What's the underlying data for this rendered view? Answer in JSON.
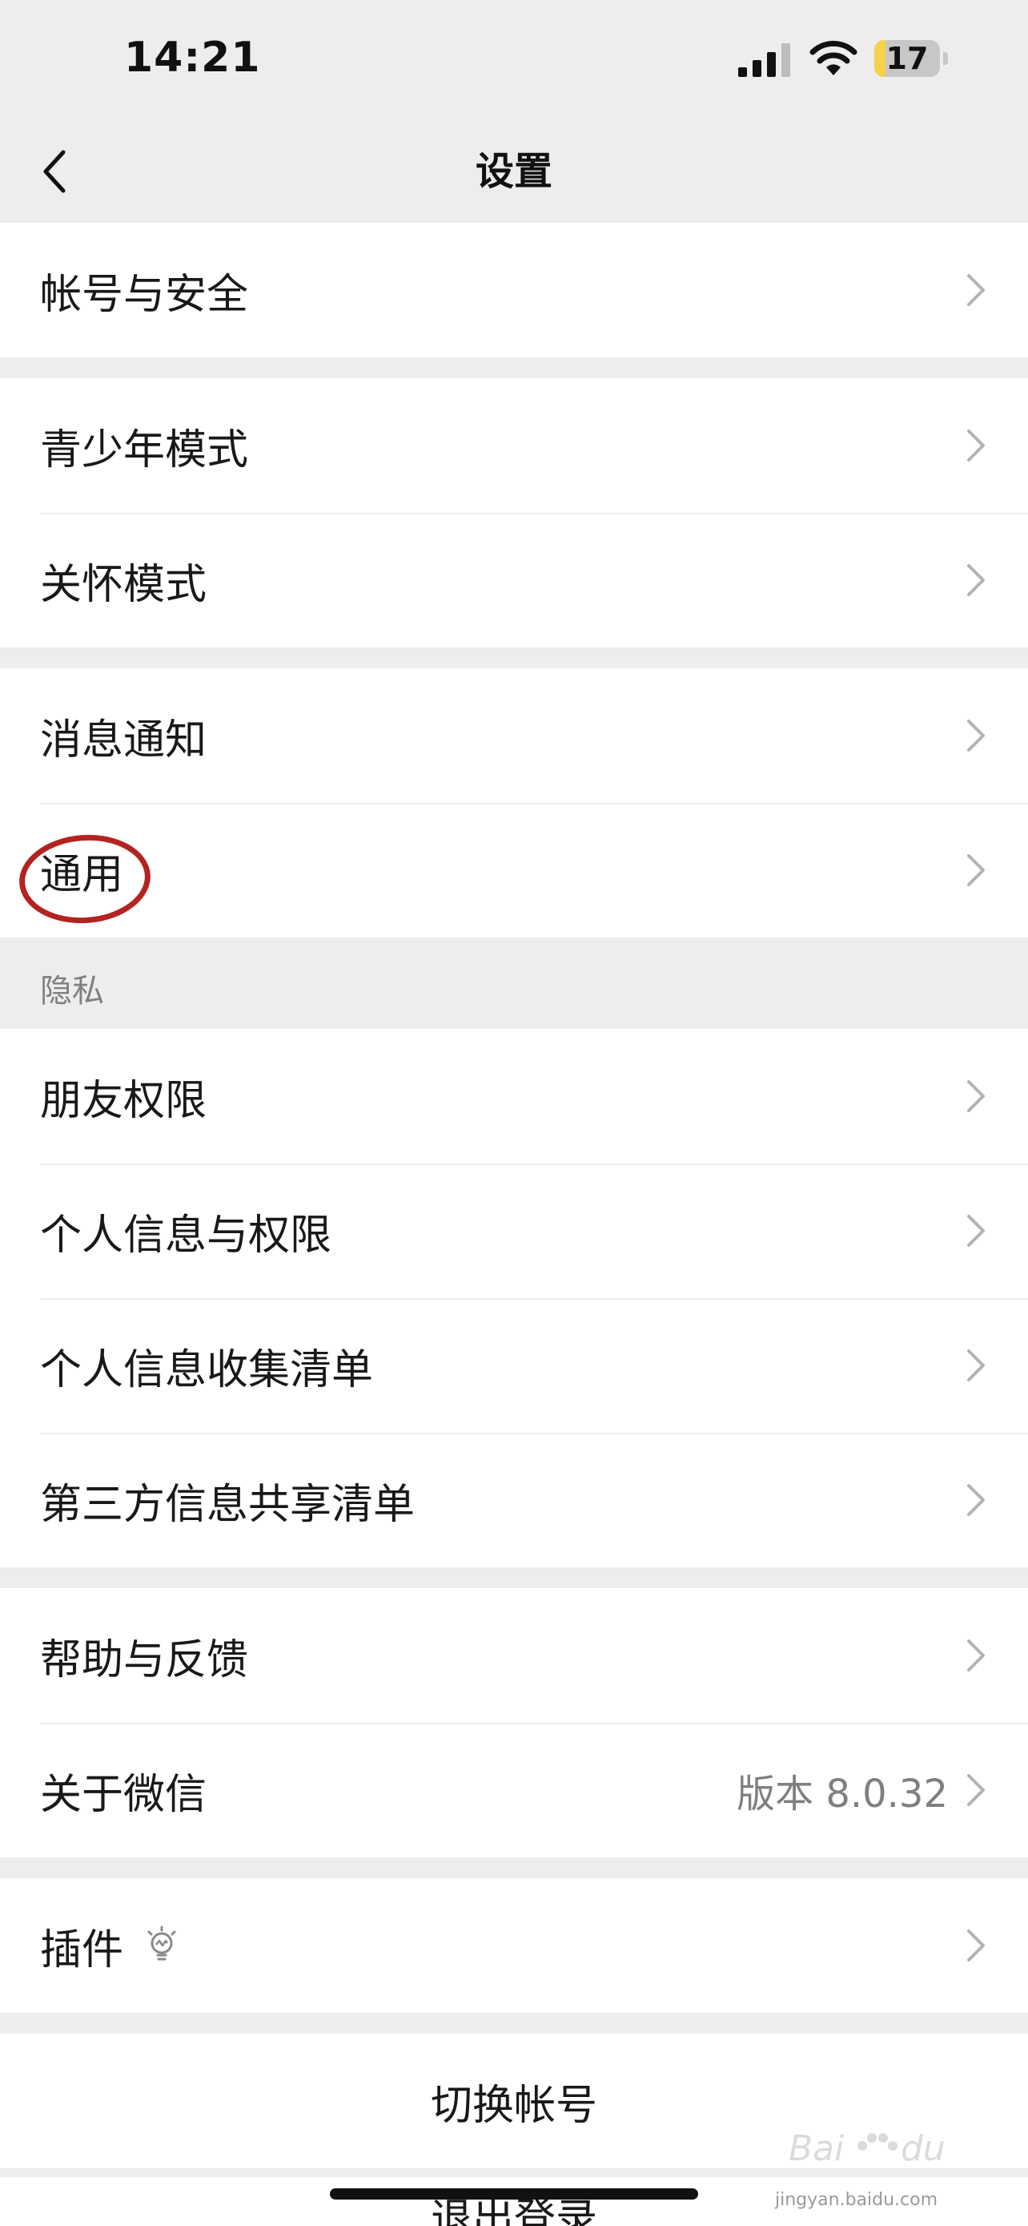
{
  "status_bar": {
    "time": "14:21",
    "battery_level": "17",
    "battery_fraction": 0.17
  },
  "nav": {
    "title": "设置"
  },
  "groups": {
    "account": {
      "items": [
        "帐号与安全"
      ]
    },
    "modes": {
      "items": [
        "青少年模式",
        "关怀模式"
      ]
    },
    "general": {
      "items": [
        "消息通知",
        "通用"
      ]
    },
    "privacy": {
      "header": "隐私",
      "items": [
        "朋友权限",
        "个人信息与权限",
        "个人信息收集清单",
        "第三方信息共享清单"
      ]
    },
    "help": {
      "items": [
        "帮助与反馈",
        "关于微信"
      ],
      "about_value": "版本 8.0.32"
    },
    "plugins": {
      "items": [
        "插件"
      ]
    }
  },
  "switch_account_label": "切换帐号",
  "logout_label": "退出登录",
  "watermark": {
    "text": "jingyan.baidu.com"
  },
  "icons": [
    "back-chevron-icon",
    "chevron-right-icon",
    "plugin-bulb-icon",
    "signal-icon",
    "wifi-icon",
    "battery-icon"
  ],
  "colors": {
    "background": "#ededed",
    "row": "#ffffff",
    "annotation": "#b4231f",
    "secondary_text": "#7f7f7f"
  }
}
